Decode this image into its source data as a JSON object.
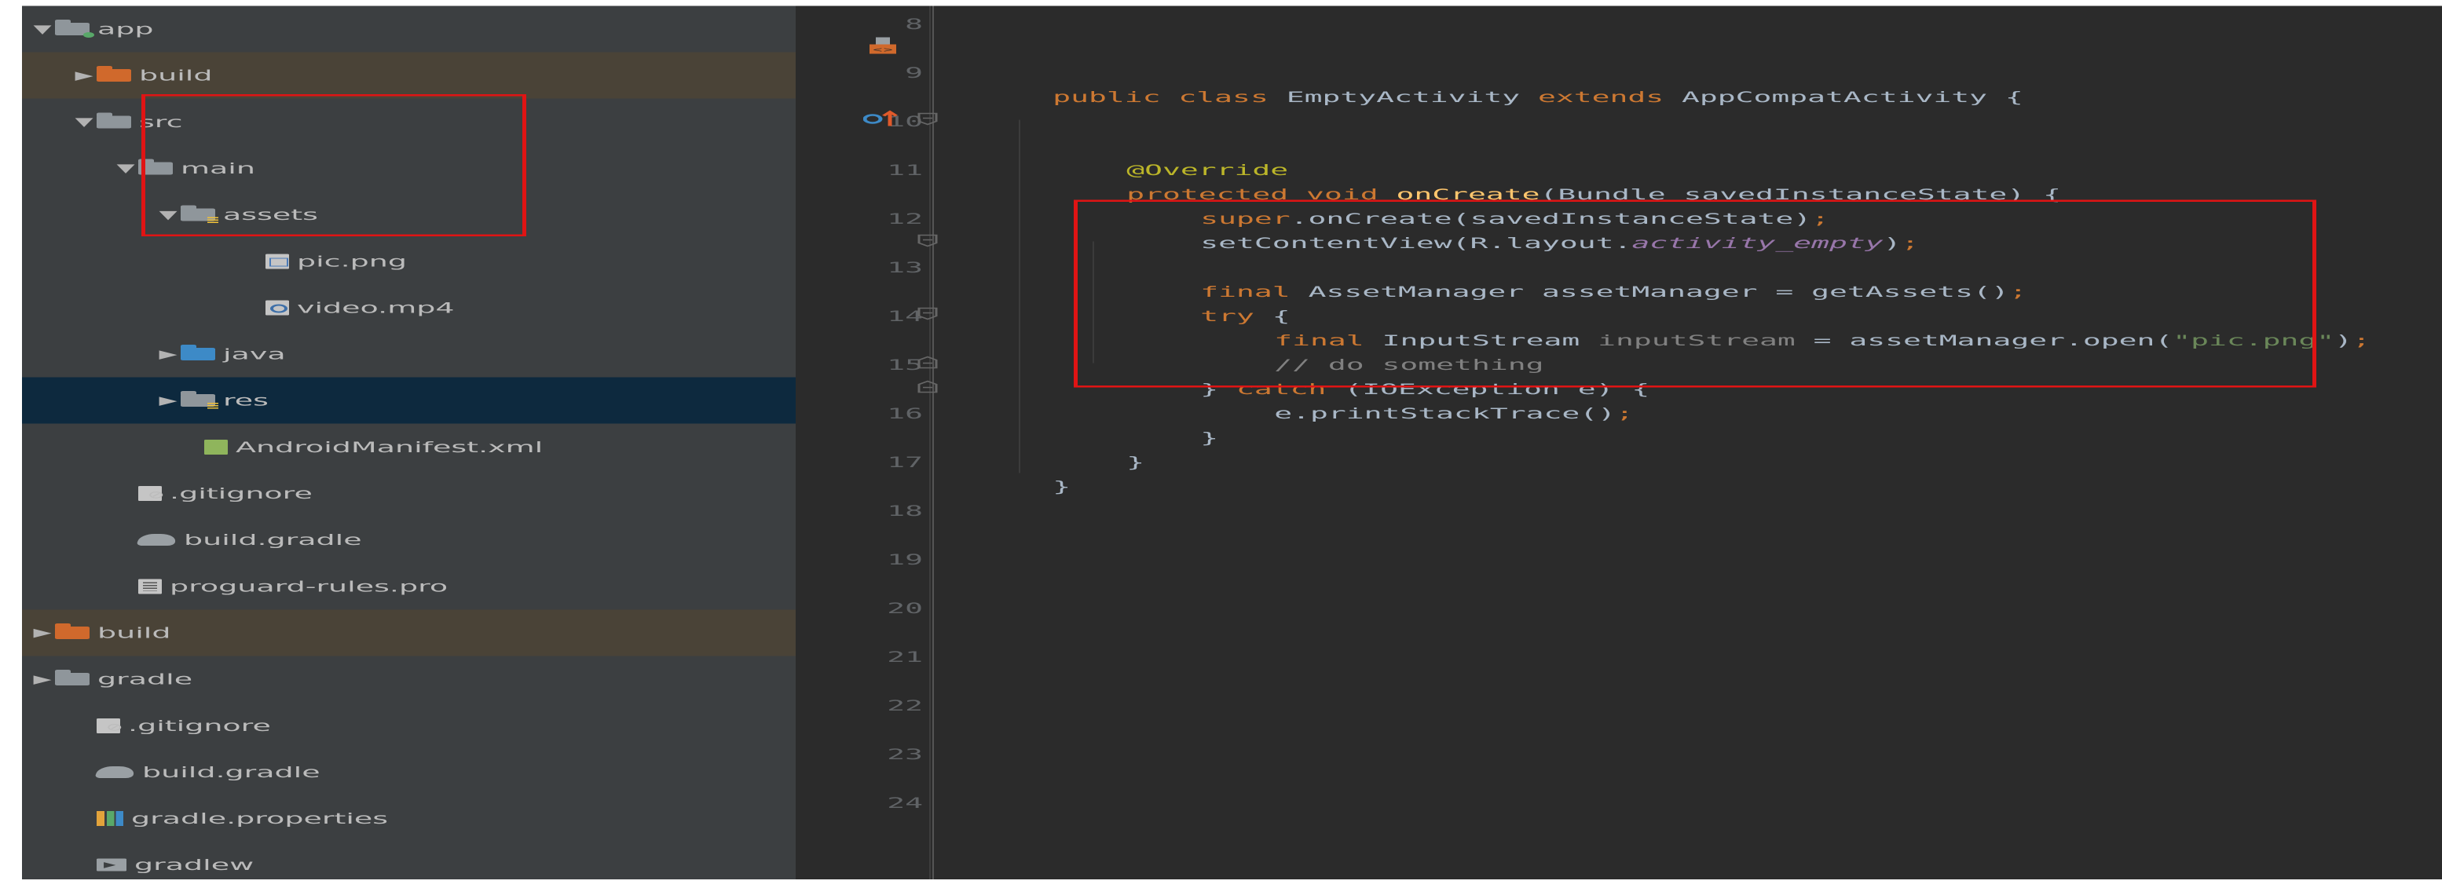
{
  "project_tree": {
    "items": [
      {
        "label": "app",
        "arrow": "▼",
        "icon": "module-folder-icon"
      },
      {
        "label": "build",
        "arrow": "▶",
        "icon": "build-folder-icon"
      },
      {
        "label": "src",
        "arrow": "▼",
        "icon": "folder-icon"
      },
      {
        "label": "main",
        "arrow": "▼",
        "icon": "folder-icon"
      },
      {
        "label": "assets",
        "arrow": "▼",
        "icon": "resource-folder-icon"
      },
      {
        "label": "pic.png",
        "arrow": "",
        "icon": "image-file-icon"
      },
      {
        "label": "video.mp4",
        "arrow": "",
        "icon": "video-file-icon"
      },
      {
        "label": "java",
        "arrow": "▶",
        "icon": "source-folder-icon"
      },
      {
        "label": "res",
        "arrow": "▶",
        "icon": "resource-folder-icon"
      },
      {
        "label": "AndroidManifest.xml",
        "arrow": "",
        "icon": "manifest-file-icon"
      },
      {
        "label": ".gitignore",
        "arrow": "",
        "icon": "gitignore-file-icon"
      },
      {
        "label": "build.gradle",
        "arrow": "",
        "icon": "gradle-icon"
      },
      {
        "label": "proguard-rules.pro",
        "arrow": "",
        "icon": "text-file-icon"
      },
      {
        "label": "build",
        "arrow": "▶",
        "icon": "build-folder-icon"
      },
      {
        "label": "gradle",
        "arrow": "▶",
        "icon": "folder-icon"
      },
      {
        "label": ".gitignore",
        "arrow": "",
        "icon": "gitignore-file-icon"
      },
      {
        "label": "build.gradle",
        "arrow": "",
        "icon": "gradle-icon"
      },
      {
        "label": "gradle.properties",
        "arrow": "",
        "icon": "properties-file-icon"
      },
      {
        "label": "gradlew",
        "arrow": "",
        "icon": "terminal-file-icon"
      }
    ]
  },
  "editor": {
    "line_numbers": [
      "8",
      "9",
      "10",
      "11",
      "12",
      "13",
      "14",
      "15",
      "16",
      "17",
      "18",
      "19",
      "20",
      "21",
      "22",
      "23",
      "24"
    ],
    "tokens": {
      "l9_kw": "public class ",
      "l9_name": "EmptyActivity ",
      "l9_kw2": "extends ",
      "l9_rest": "AppCompatActivity {",
      "l11_ann": "@Override",
      "l12_kw": "protected void ",
      "l12_fn": "onCreate",
      "l12_rest": "(Bundle savedInstanceState) {",
      "l13_kw": "super",
      "l13_rest": ".onCreate(savedInstanceState)",
      "l13_semi": ";",
      "l14_a": "setContentView(R.layout.",
      "l14_field": "activity_empty",
      "l14_b": ")",
      "l14_semi": ";",
      "l16_kw": "final ",
      "l16_rest": "AssetManager assetManager = getAssets()",
      "l16_semi": ";",
      "l17_kw": "try ",
      "l17_rest": "{",
      "l18_kw": "final ",
      "l18_type": "InputStream ",
      "l18_var": "inputStream",
      "l18_mid": " = assetManager.open(",
      "l18_str": "\"pic.png\"",
      "l18_end": ")",
      "l18_semi": ";",
      "l19_cmt": "// do something",
      "l20_a": "} ",
      "l20_kw": "catch ",
      "l20_rest": "(IOException e) {",
      "l21_rest": "e.printStackTrace()",
      "l21_semi": ";",
      "l22": "}",
      "l23": "}",
      "l24": "}"
    }
  },
  "colors": {
    "sidebar_bg": "#3c3f41",
    "editor_bg": "#2b2b2b",
    "keyword": "#cc7832",
    "annotation": "#bbb529",
    "method": "#ffc66d",
    "string": "#6a8759",
    "comment": "#808080",
    "field": "#9876aa",
    "highlight_box": "#e01414"
  }
}
